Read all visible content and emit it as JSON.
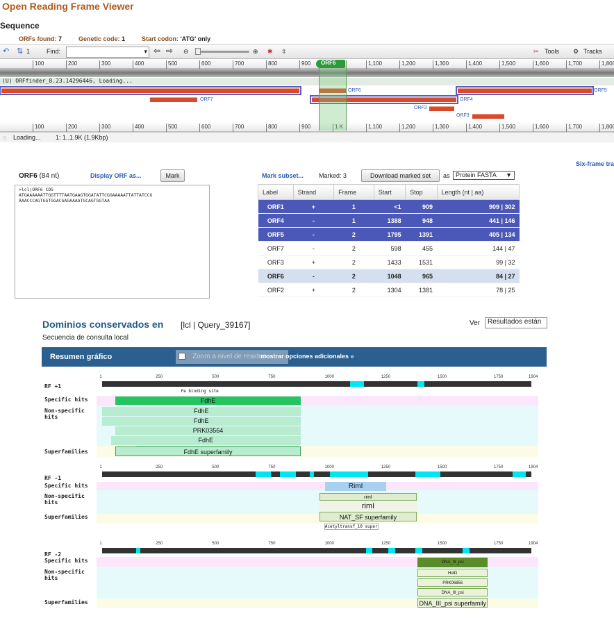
{
  "app": {
    "title": "Open Reading Frame Viewer",
    "section": "Sequence"
  },
  "info": {
    "orfs_found_label": "ORFs found:",
    "orfs_found": "7",
    "genetic_code_label": "Genetic code:",
    "genetic_code": "1",
    "start_codon_label": "Start codon:",
    "start_codon": "'ATG' only"
  },
  "toolbar": {
    "find_label": "Find:",
    "tools": "Tools",
    "tracks": "Tracks",
    "count": "1"
  },
  "ruler": {
    "ticks": [
      "100",
      "200",
      "300",
      "400",
      "500",
      "600",
      "700",
      "800",
      "900",
      "1,100",
      "1,200",
      "1,300",
      "1,400",
      "1,500",
      "1,600",
      "1,700",
      "1,800"
    ],
    "ticks_bottom": [
      "100",
      "200",
      "300",
      "400",
      "500",
      "600",
      "700",
      "800",
      "900",
      "1 K",
      "1,100",
      "1,200",
      "1,300",
      "1,400",
      "1,500",
      "1,600",
      "1,700",
      "1,800"
    ]
  },
  "track": {
    "loading_text": "(U) ORFfinder_8.23.14296446, Loading...",
    "orf6_tag": "ORF6"
  },
  "orf_labels": {
    "orf6": "ORF6",
    "orf5": "ORF5",
    "orf7": "ORF7",
    "orf4": "ORF4",
    "orf2": "ORF2",
    "orf3": "ORF3"
  },
  "status": {
    "loading": "Loading...",
    "range": "1: 1..1.9K (1.9Kbp)"
  },
  "six_frame": "Six-frame tra",
  "orf_panel": {
    "name": "ORF6",
    "length": "(84 nt)",
    "display_link": "Display ORF as...",
    "mark_button": "Mark",
    "sequence": ">lcl|ORF6 CDS\nATGAAAAAATTGGTTTTAATGAAGTGGATATTCGGAAAAATTATTATCCG\nAAACCCAGTGGTGGACGAGAAAATGCAGTGGTAA"
  },
  "subset": {
    "mark_subset": "Mark subset...",
    "marked": "Marked: 3",
    "download": "Download marked set",
    "as": "as",
    "format": "Protein FASTA"
  },
  "table": {
    "headers": [
      "Label",
      "Strand",
      "Frame",
      "Start",
      "Stop",
      "Length (nt | aa)"
    ],
    "rows": [
      {
        "label": "ORF1",
        "strand": "+",
        "frame": "1",
        "start": "<1",
        "stop": "909",
        "length": "909 | 302"
      },
      {
        "label": "ORF4",
        "strand": "-",
        "frame": "1",
        "start": "1388",
        "stop": "948",
        "length": "441 | 146"
      },
      {
        "label": "ORF5",
        "strand": "-",
        "frame": "2",
        "start": "1795",
        "stop": "1391",
        "length": "405 | 134"
      },
      {
        "label": "ORF7",
        "strand": "-",
        "frame": "2",
        "start": "598",
        "stop": "455",
        "length": "144 | 47"
      },
      {
        "label": "ORF3",
        "strand": "+",
        "frame": "2",
        "start": "1433",
        "stop": "1531",
        "length": "99 | 32"
      },
      {
        "label": "ORF6",
        "strand": "-",
        "frame": "2",
        "start": "1048",
        "stop": "965",
        "length": "84 | 27"
      },
      {
        "label": "ORF2",
        "strand": "+",
        "frame": "2",
        "start": "1304",
        "stop": "1381",
        "length": "78 | 25"
      }
    ]
  },
  "cd": {
    "title": "Dominios conservados en",
    "query": "[lcl | Query_39167]",
    "subtitle": "Secuencia de consulta local",
    "ver_label": "Ver",
    "ver_value": "Resultados están",
    "graph_title": "Resumen gráfico",
    "zoom": "Zoom a nivel de residuo",
    "more": "mostrar opciones adicionales »",
    "axis_ticks": [
      "1",
      "250",
      "500",
      "750",
      "1000",
      "1250",
      "1500",
      "1750",
      "1904"
    ]
  },
  "rf1": {
    "label": "RF +1",
    "specific": "Specific hits",
    "nonspecific": "Non-specific hits",
    "superfamilies": "Superfamilies",
    "site": "Fe binding site",
    "hits": [
      "FdhE",
      "FdhE",
      "PRK03564",
      "FdhE",
      "FdhE"
    ],
    "super": "FdhE superfamily",
    "specific_hit": "FdhE"
  },
  "rf_1": {
    "label": "RF -1",
    "specific": "Specific hits",
    "nonspecific": "Non-specific hits",
    "superfamilies": "Superfamilies",
    "specific_hit": "RimI",
    "hits": [
      "rimI",
      "rimI"
    ],
    "super": "NAT_SF superfamily",
    "extra": "Acetyltransf_10 super"
  },
  "rf_2": {
    "label": "RF -2",
    "specific": "Specific hits",
    "nonspecific": "Non-specific hits",
    "superfamilies": "Superfamilies",
    "specific_hit": "DNA_III_psi",
    "hits": [
      "HolD",
      "PRK06856",
      "DNA_III_psi"
    ],
    "super": "DNA_III_psi superfamily"
  }
}
